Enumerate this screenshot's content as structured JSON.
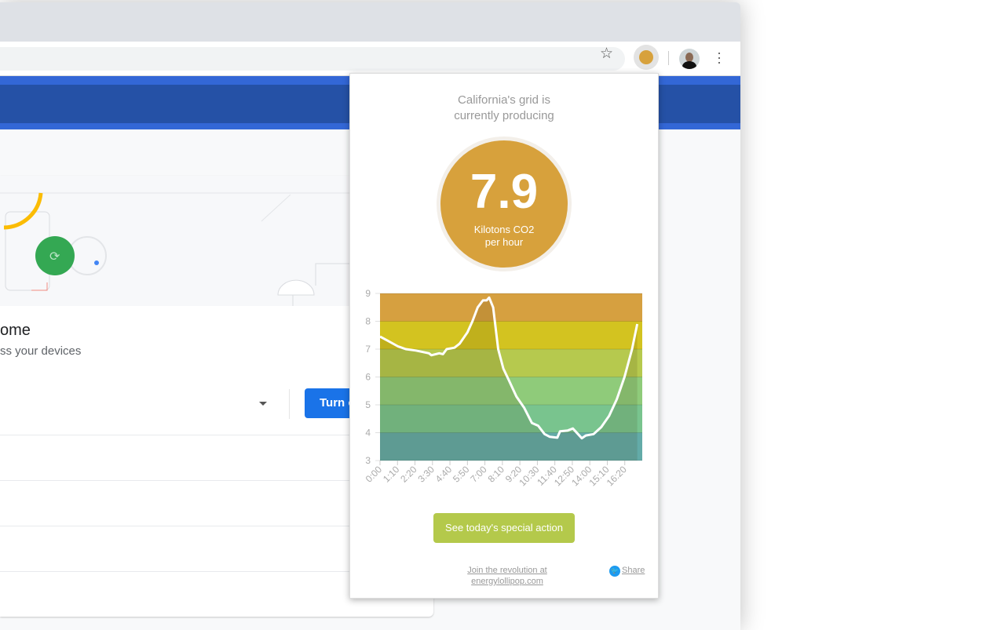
{
  "popup": {
    "title_line1": "California's grid is",
    "title_line2": "currently producing",
    "value": "7.9",
    "unit_line1": "Kilotons CO2",
    "unit_line2": "per hour",
    "action_label": "See today's special action",
    "join_line1": "Join the revolution at",
    "join_line2": "energylollipop.com",
    "share_label": "Share",
    "colors": {
      "circle": "#d7a13c",
      "button": "#b4c94b"
    }
  },
  "page": {
    "title_fragment": "ome",
    "subtitle_fragment": "ss your devices",
    "turn_button": "Turn o"
  },
  "chart_data": {
    "type": "area",
    "ylim": [
      3,
      9
    ],
    "yticks": [
      3,
      4,
      5,
      6,
      7,
      8,
      9
    ],
    "xticks": [
      "0:00",
      "1:10",
      "2:20",
      "3:30",
      "4:40",
      "5:50",
      "7:00",
      "8:10",
      "9:20",
      "10:30",
      "11:40",
      "12:50",
      "14:00",
      "15:10",
      "16:20"
    ],
    "bands": [
      {
        "range": [
          8,
          9
        ],
        "color": "#d6a040"
      },
      {
        "range": [
          7,
          8
        ],
        "color": "#d3c320"
      },
      {
        "range": [
          6,
          7
        ],
        "color": "#b6c94e"
      },
      {
        "range": [
          5,
          6
        ],
        "color": "#8fcb7a"
      },
      {
        "range": [
          4,
          5
        ],
        "color": "#79c48e"
      },
      {
        "range": [
          3,
          4
        ],
        "color": "#63aba8"
      }
    ],
    "points": [
      [
        "0:00",
        7.45
      ],
      [
        "0:31",
        7.3
      ],
      [
        "1:12",
        7.1
      ],
      [
        "1:43",
        7.0
      ],
      [
        "2:24",
        6.95
      ],
      [
        "3:16",
        6.85
      ],
      [
        "3:26",
        6.78
      ],
      [
        "3:57",
        6.85
      ],
      [
        "4:12",
        6.82
      ],
      [
        "4:27",
        7.0
      ],
      [
        "4:58",
        7.05
      ],
      [
        "5:19",
        7.2
      ],
      [
        "5:50",
        7.6
      ],
      [
        "6:10",
        8.0
      ],
      [
        "6:31",
        8.5
      ],
      [
        "6:52",
        8.75
      ],
      [
        "7:07",
        8.75
      ],
      [
        "7:17",
        8.85
      ],
      [
        "7:33",
        8.5
      ],
      [
        "7:53",
        7.0
      ],
      [
        "8:14",
        6.3
      ],
      [
        "8:35",
        5.9
      ],
      [
        "9:06",
        5.3
      ],
      [
        "9:37",
        4.9
      ],
      [
        "10:08",
        4.35
      ],
      [
        "10:33",
        4.25
      ],
      [
        "10:59",
        3.95
      ],
      [
        "11:20",
        3.85
      ],
      [
        "11:50",
        3.82
      ],
      [
        "12:01",
        4.05
      ],
      [
        "12:32",
        4.08
      ],
      [
        "12:52",
        4.15
      ],
      [
        "13:13",
        3.95
      ],
      [
        "13:28",
        3.8
      ],
      [
        "13:44",
        3.9
      ],
      [
        "14:15",
        3.95
      ],
      [
        "14:46",
        4.2
      ],
      [
        "15:17",
        4.6
      ],
      [
        "15:48",
        5.2
      ],
      [
        "16:19",
        6.0
      ],
      [
        "16:49",
        7.0
      ],
      [
        "17:10",
        7.9
      ]
    ],
    "xmax": "17:30"
  }
}
